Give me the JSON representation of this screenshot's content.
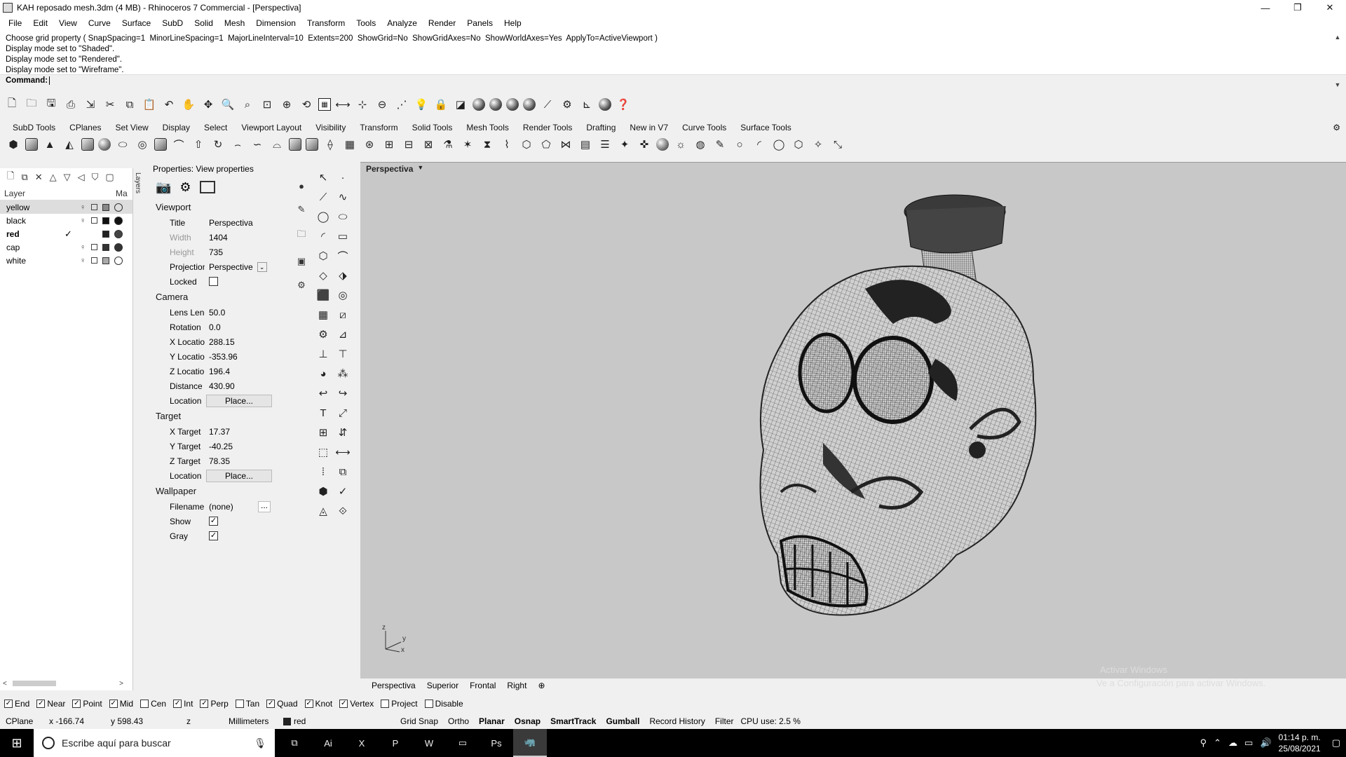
{
  "window": {
    "title": "KAH reposado mesh.3dm (4 MB) - Rhinoceros 7 Commercial - [Perspectiva]",
    "minimize": "—",
    "maximize": "❐",
    "close": "✕"
  },
  "menu": [
    "File",
    "Edit",
    "View",
    "Curve",
    "Surface",
    "SubD",
    "Solid",
    "Mesh",
    "Dimension",
    "Transform",
    "Tools",
    "Analyze",
    "Render",
    "Panels",
    "Help"
  ],
  "history": {
    "lines": [
      "Choose grid property ( SnapSpacing=1  MinorLineSpacing=1  MajorLineInterval=10  Extents=200  ShowGrid=No  ShowGridAxes=No  ShowWorldAxes=Yes  ApplyTo=ActiveViewport )",
      "Display mode set to \"Shaded\".",
      "Display mode set to \"Rendered\".",
      "Display mode set to \"Wireframe\"."
    ],
    "prompt": "Command:"
  },
  "toolbar_tabs": [
    "SubD Tools",
    "CPlanes",
    "Set View",
    "Display",
    "Select",
    "Viewport Layout",
    "Visibility",
    "Transform",
    "Solid Tools",
    "Mesh Tools",
    "Render Tools",
    "Drafting",
    "New in V7",
    "Curve Tools",
    "Surface Tools"
  ],
  "layers": {
    "col_layer": "Layer",
    "col_material": "Ma",
    "side_tab": "Layers",
    "rows": [
      {
        "name": "yellow",
        "current": false,
        "selected": true,
        "color": "#888888",
        "material_fill": "#dddddd"
      },
      {
        "name": "black",
        "current": false,
        "selected": false,
        "color": "#111111",
        "material_fill": "#111111"
      },
      {
        "name": "red",
        "current": true,
        "selected": false,
        "color": "#222222",
        "material_fill": "#444444"
      },
      {
        "name": "cap",
        "current": false,
        "selected": false,
        "color": "#333333",
        "material_fill": "#333333"
      },
      {
        "name": "white",
        "current": false,
        "selected": false,
        "color": "#aaaaaa",
        "material_fill": "#ffffff"
      }
    ],
    "check_glyph": "✓"
  },
  "properties": {
    "header": "Properties: View properties",
    "viewport_section": "Viewport",
    "title_label": "Title",
    "title_value": "Perspectiva",
    "width_label": "Width",
    "width_value": "1404",
    "height_label": "Height",
    "height_value": "735",
    "projection_label": "Projection",
    "projection_value": "Perspective",
    "locked_label": "Locked",
    "camera_section": "Camera",
    "lens_label": "Lens Length",
    "lens_value": "50.0",
    "rotation_label": "Rotation",
    "rotation_value": "0.0",
    "xloc_label": "X Location",
    "xloc_value": "288.15",
    "yloc_label": "Y Location",
    "yloc_value": "-353.96",
    "zloc_label": "Z Location",
    "zloc_value": "196.4",
    "dist_label": "Distance to ...",
    "dist_value": "430.90",
    "location_label": "Location",
    "place_button": "Place...",
    "target_section": "Target",
    "xt_label": "X Target",
    "xt_value": "17.37",
    "yt_label": "Y Target",
    "yt_value": "-40.25",
    "zt_label": "Z Target",
    "zt_value": "78.35",
    "tlocation_label": "Location",
    "wallpaper_section": "Wallpaper",
    "filename_label": "Filename",
    "filename_value": "(none)",
    "dots": "...",
    "show_label": "Show",
    "gray_label": "Gray",
    "check_glyph": "✓"
  },
  "viewport": {
    "name": "Perspectiva",
    "axis_z": "z",
    "axis_y": "y",
    "axis_x": "x",
    "watermark_line1": "Activar Windows",
    "watermark_line2": "Ve a Configuración para activar Windows."
  },
  "viewport_tabs": [
    "Perspectiva",
    "Superior",
    "Frontal",
    "Right"
  ],
  "osnaps": [
    {
      "label": "End",
      "checked": true
    },
    {
      "label": "Near",
      "checked": true
    },
    {
      "label": "Point",
      "checked": true
    },
    {
      "label": "Mid",
      "checked": true
    },
    {
      "label": "Cen",
      "checked": false
    },
    {
      "label": "Int",
      "checked": true
    },
    {
      "label": "Perp",
      "checked": true
    },
    {
      "label": "Tan",
      "checked": false
    },
    {
      "label": "Quad",
      "checked": true
    },
    {
      "label": "Knot",
      "checked": true
    },
    {
      "label": "Vertex",
      "checked": true
    },
    {
      "label": "Project",
      "checked": false
    },
    {
      "label": "Disable",
      "checked": false
    }
  ],
  "status": {
    "cplane": "CPlane",
    "x": "x -166.74",
    "y": "y 598.43",
    "z": "z",
    "units": "Millimeters",
    "layer": "red",
    "grid_snap": "Grid Snap",
    "ortho": "Ortho",
    "planar": "Planar",
    "osnap": "Osnap",
    "smarttrack": "SmartTrack",
    "gumball": "Gumball",
    "record_history": "Record History",
    "filter": "Filter",
    "cpu": "CPU use: 2.5 %"
  },
  "taskbar": {
    "search_placeholder": "Escribe aquí para buscar",
    "apps": [
      "⧉",
      "Ai",
      "X",
      "P",
      "W",
      "▭",
      "Ps",
      "🦏"
    ],
    "time": "01:14 p. m.",
    "date": "25/08/2021"
  }
}
